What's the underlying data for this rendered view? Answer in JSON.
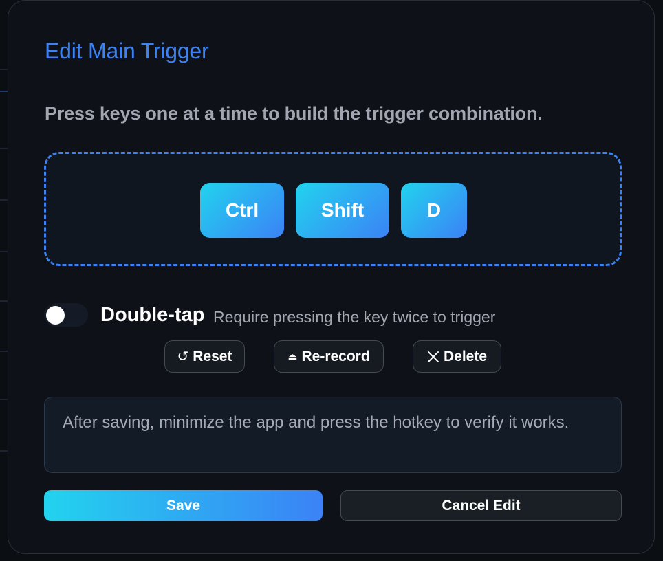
{
  "dialog": {
    "title": "Edit Main Trigger",
    "instruction": "Press keys one at a time to build the trigger combination."
  },
  "keys": [
    "Ctrl",
    "Shift",
    "D"
  ],
  "double_tap": {
    "label": "Double-tap",
    "description": "Require pressing the key twice to trigger",
    "enabled": false
  },
  "actions": {
    "reset": {
      "label": "Reset",
      "icon": "reset-icon",
      "glyph": "↺"
    },
    "rerecord": {
      "label": "Re-record",
      "icon": "eject-icon",
      "glyph": "⏏"
    },
    "delete": {
      "label": "Delete",
      "icon": "close-icon"
    }
  },
  "info": "After saving, minimize the app and press the hotkey to verify it works.",
  "footer": {
    "save_label": "Save",
    "cancel_label": "Cancel Edit"
  },
  "colors": {
    "accent": "#3b82f6",
    "gradient_start": "#22d3ee",
    "gradient_end": "#3b82f6",
    "dialog_bg": "#0e1218"
  }
}
